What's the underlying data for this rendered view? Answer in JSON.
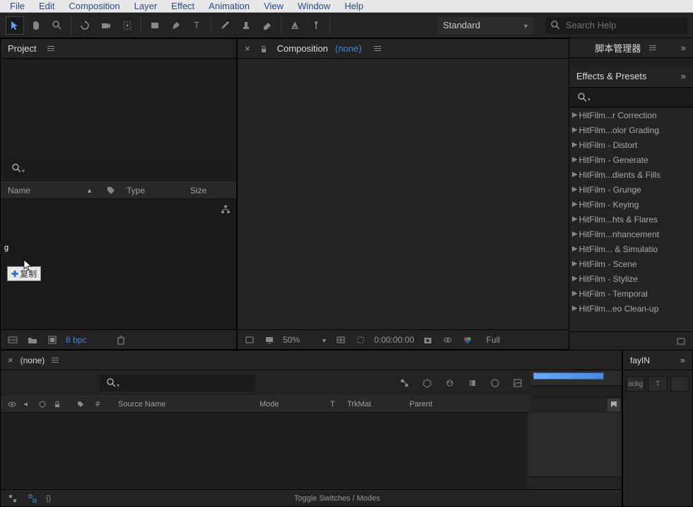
{
  "menubar": [
    "File",
    "Edit",
    "Composition",
    "Layer",
    "Effect",
    "Animation",
    "View",
    "Window",
    "Help"
  ],
  "toolbar": {
    "workspace": "Standard",
    "search_placeholder": "Search Help"
  },
  "project": {
    "title": "Project",
    "cols": {
      "name": "Name",
      "type": "Type",
      "size": "Size"
    },
    "bpc": "8 bpc",
    "tooltip_g": "g",
    "tooltip_copy": "复制"
  },
  "composition": {
    "title": "Composition",
    "sub": "(none)",
    "zoom": "50%",
    "timecode": "0:00:00:00",
    "res": "Full"
  },
  "script_mgr": {
    "title": "脚本管理器"
  },
  "effects": {
    "title": "Effects & Presets",
    "items": [
      "HitFilm...r Correction",
      "HitFilm...olor Grading",
      "HitFilm - Distort",
      "HitFilm - Generate",
      "HitFilm...dients & Fills",
      "HitFilm - Grunge",
      "HitFilm - Keying",
      "HitFilm...hts & Flares",
      "HitFilm...nhancement",
      "HitFilm... & Simulatio",
      "HitFilm - Scene",
      "HitFilm - Stylize",
      "HitFilm - Temporal",
      "HitFilm...eo Clean-up"
    ]
  },
  "timeline": {
    "title": "(none)",
    "cols": {
      "num": "#",
      "source": "Source Name",
      "mode": "Mode",
      "t": "T",
      "trkmat": "TrkMat",
      "parent": "Parent"
    },
    "toggle": "Toggle Switches / Modes"
  },
  "fayin": {
    "title": "fayIN",
    "btn1": "ackg",
    "btn2": "T"
  }
}
